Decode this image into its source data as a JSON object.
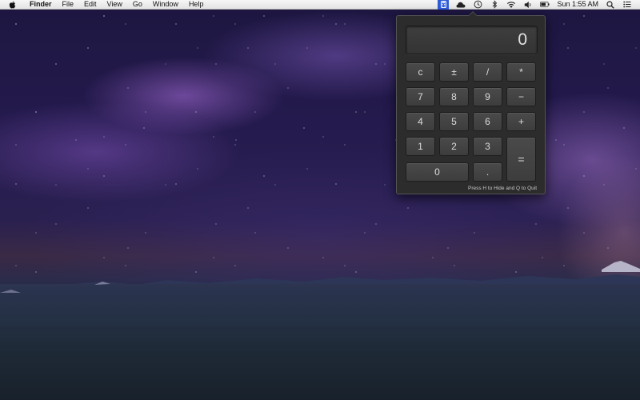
{
  "menubar": {
    "app_name": "Finder",
    "items": [
      "File",
      "Edit",
      "View",
      "Go",
      "Window",
      "Help"
    ],
    "clock": "Sun 1:55 AM"
  },
  "calculator": {
    "display": "0",
    "keys": {
      "clear": "c",
      "plus_minus": "±",
      "divide": "/",
      "multiply": "*",
      "seven": "7",
      "eight": "8",
      "nine": "9",
      "minus": "−",
      "four": "4",
      "five": "5",
      "six": "6",
      "plus": "+",
      "one": "1",
      "two": "2",
      "three": "3",
      "equals": "=",
      "zero": "0",
      "decimal": "."
    },
    "hint": "Press H to Hide and Q to Quit"
  },
  "colors": {
    "menubar_bg": "#e8e8e8",
    "status_highlight": "#2f5bd8",
    "popover_bg": "#2c2c2c",
    "key_bg": "#444444",
    "display_text": "#e2e2e2"
  },
  "icons": [
    "apple-icon",
    "calculator-status-icon",
    "cloud-icon",
    "time-machine-icon",
    "bluetooth-icon",
    "wifi-icon",
    "volume-icon",
    "battery-icon",
    "spotlight-icon",
    "notification-list-icon"
  ]
}
